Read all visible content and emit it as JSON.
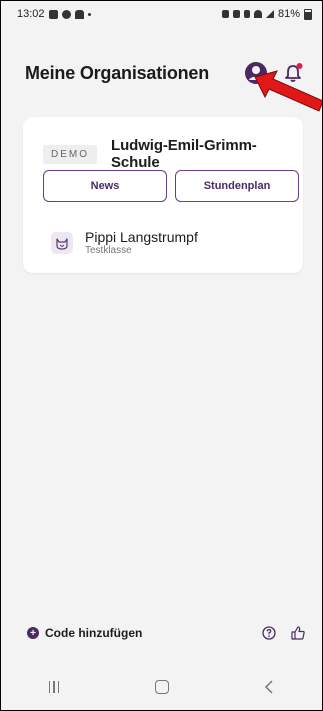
{
  "status_bar": {
    "time": "13:02",
    "battery": "81%"
  },
  "header": {
    "title": "Meine Organisationen"
  },
  "organization": {
    "badge": "DEMO",
    "name": "Ludwig-Emil-Grimm-Schule",
    "buttons": [
      "News",
      "Stundenplan"
    ],
    "class": {
      "name": "Pippi Langstrumpf",
      "subtitle": "Testklasse"
    }
  },
  "footer": {
    "add_code_label": "Code hinzufügen"
  },
  "colors": {
    "accent": "#4b2a63",
    "notification_dot": "#e8194b",
    "arrow": "#e01818"
  }
}
